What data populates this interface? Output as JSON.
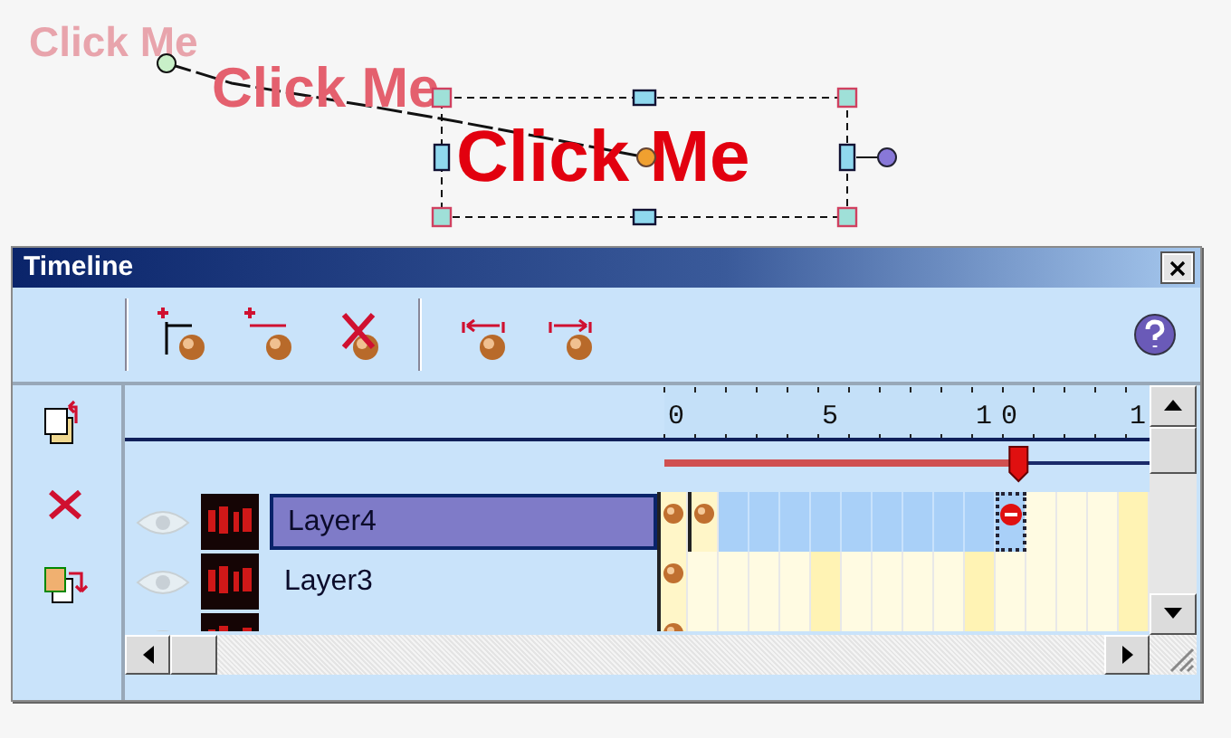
{
  "canvas": {
    "texts": [
      {
        "text": "Click Me",
        "kind": "ghost-far"
      },
      {
        "text": "Click Me",
        "kind": "ghost-near"
      },
      {
        "text": "Click Me",
        "kind": "current"
      }
    ]
  },
  "timeline": {
    "title": "Timeline",
    "ruler_labels": [
      "0",
      "5",
      "10",
      "1"
    ],
    "playhead": {
      "level": 0.73
    },
    "layers": [
      {
        "name": "Layer4",
        "selected": true,
        "frames": [
          {
            "kind": "key"
          },
          {
            "kind": "key"
          },
          {
            "kind": "tween"
          },
          {
            "kind": "tween"
          },
          {
            "kind": "tween"
          },
          {
            "kind": "tween"
          },
          {
            "kind": "tween"
          },
          {
            "kind": "tween"
          },
          {
            "kind": "tween"
          },
          {
            "kind": "tween"
          },
          {
            "kind": "tween"
          },
          {
            "kind": "stop"
          },
          {
            "kind": "empty"
          },
          {
            "kind": "empty"
          },
          {
            "kind": "empty"
          },
          {
            "kind": "empty"
          }
        ]
      },
      {
        "name": "Layer3",
        "selected": false,
        "frames": [
          {
            "kind": "key"
          },
          {
            "kind": "empty"
          },
          {
            "kind": "empty"
          },
          {
            "kind": "empty"
          },
          {
            "kind": "empty"
          },
          {
            "kind": "empty"
          },
          {
            "kind": "empty"
          },
          {
            "kind": "empty"
          },
          {
            "kind": "empty"
          },
          {
            "kind": "empty"
          },
          {
            "kind": "empty"
          },
          {
            "kind": "empty"
          },
          {
            "kind": "empty"
          },
          {
            "kind": "empty"
          },
          {
            "kind": "empty"
          },
          {
            "kind": "empty"
          }
        ]
      },
      {
        "frames": [
          {
            "kind": "key"
          },
          {
            "kind": "empty"
          },
          {
            "kind": "empty"
          },
          {
            "kind": "empty"
          },
          {
            "kind": "empty"
          },
          {
            "kind": "empty"
          },
          {
            "kind": "empty"
          },
          {
            "kind": "empty"
          },
          {
            "kind": "empty"
          },
          {
            "kind": "empty"
          },
          {
            "kind": "empty"
          },
          {
            "kind": "empty"
          },
          {
            "kind": "empty"
          },
          {
            "kind": "empty"
          },
          {
            "kind": "empty"
          },
          {
            "kind": "empty"
          }
        ]
      }
    ]
  }
}
